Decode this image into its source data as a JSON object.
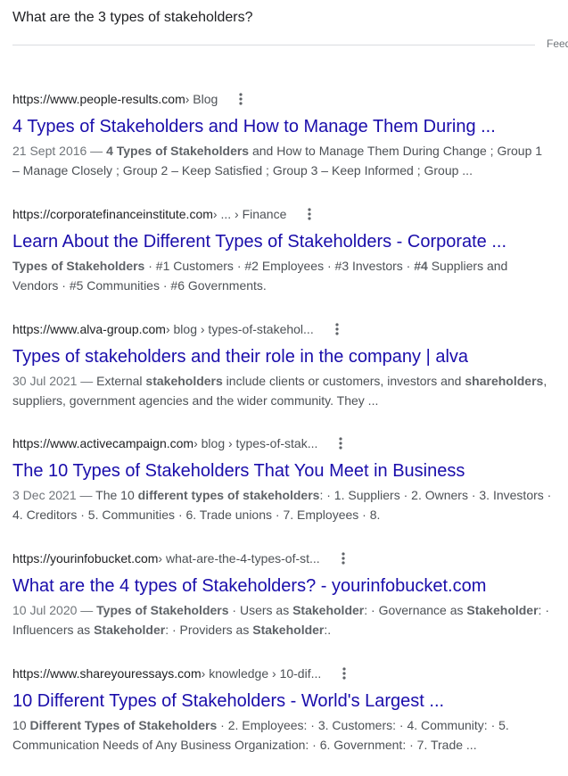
{
  "search": {
    "query": "What are the 3 types of stakeholders?",
    "feedback": "Feedback"
  },
  "results": [
    {
      "host": "https://www.people-results.com",
      "path": " › Blog",
      "title": "4 Types of Stakeholders and How to Manage Them During ...",
      "snippet": [
        {
          "t": "21 Sept 2016 — ",
          "c": "date"
        },
        {
          "t": "4 Types of Stakeholders",
          "b": true
        },
        {
          "t": " and How to Manage Them During Change ; Group 1 – Manage Closely ; Group 2 – Keep Satisfied ; Group 3 – Keep Informed ; Group ..."
        }
      ]
    },
    {
      "host": "https://corporatefinanceinstitute.com",
      "path": " › ... › Finance",
      "title": "Learn About the Different Types of Stakeholders - Corporate ...",
      "snippet": [
        {
          "t": "Types of Stakeholders",
          "b": true
        },
        {
          "t": " · #1 Customers · #2 Employees · #3 Investors · "
        },
        {
          "t": "#4",
          "b": true
        },
        {
          "t": " Suppliers and Vendors · #5 Communities · #6 Governments."
        }
      ]
    },
    {
      "host": "https://www.alva-group.com",
      "path": " › blog › types-of-stakehol...",
      "title": "Types of stakeholders and their role in the company | alva",
      "snippet": [
        {
          "t": "30 Jul 2021 — ",
          "c": "date"
        },
        {
          "t": "External "
        },
        {
          "t": "stakeholders",
          "b": true
        },
        {
          "t": " include clients or customers, investors and "
        },
        {
          "t": "shareholders",
          "b": true
        },
        {
          "t": ", suppliers, government agencies and the wider community. They ..."
        }
      ]
    },
    {
      "host": "https://www.activecampaign.com",
      "path": " › blog › types-of-stak...",
      "title": "The 10 Types of Stakeholders That You Meet in Business",
      "snippet": [
        {
          "t": "3 Dec 2021 — ",
          "c": "date"
        },
        {
          "t": "The 10 "
        },
        {
          "t": "different types of stakeholders",
          "b": true
        },
        {
          "t": ": · 1. Suppliers · 2. Owners · 3. Investors · 4. Creditors · 5. Communities · 6. Trade unions · 7. Employees · 8."
        }
      ]
    },
    {
      "host": "https://yourinfobucket.com",
      "path": " › what-are-the-4-types-of-st...",
      "title": "What are the 4 types of Stakeholders? - yourinfobucket.com",
      "snippet": [
        {
          "t": "10 Jul 2020 — ",
          "c": "date"
        },
        {
          "t": "Types of Stakeholders",
          "b": true
        },
        {
          "t": " · Users as "
        },
        {
          "t": "Stakeholder",
          "b": true
        },
        {
          "t": ": · Governance as "
        },
        {
          "t": "Stakeholder",
          "b": true
        },
        {
          "t": ": · Influencers as "
        },
        {
          "t": "Stakeholder",
          "b": true
        },
        {
          "t": ": · Providers as "
        },
        {
          "t": "Stakeholder",
          "b": true
        },
        {
          "t": ":."
        }
      ]
    },
    {
      "host": "https://www.shareyouressays.com",
      "path": " › knowledge › 10-dif...",
      "title": "10 Different Types of Stakeholders - World's Largest ...",
      "snippet": [
        {
          "t": "10 "
        },
        {
          "t": "Different Types of Stakeholders",
          "b": true
        },
        {
          "t": " · 2. Employees: · 3. Customers: · 4. Community: · 5. Communication Needs of Any Business Organization: · 6. Government: · 7. Trade ..."
        }
      ]
    }
  ],
  "colors": {
    "link": "#1a0dab",
    "snippet": "#4d5156",
    "divider": "#dadce0"
  }
}
